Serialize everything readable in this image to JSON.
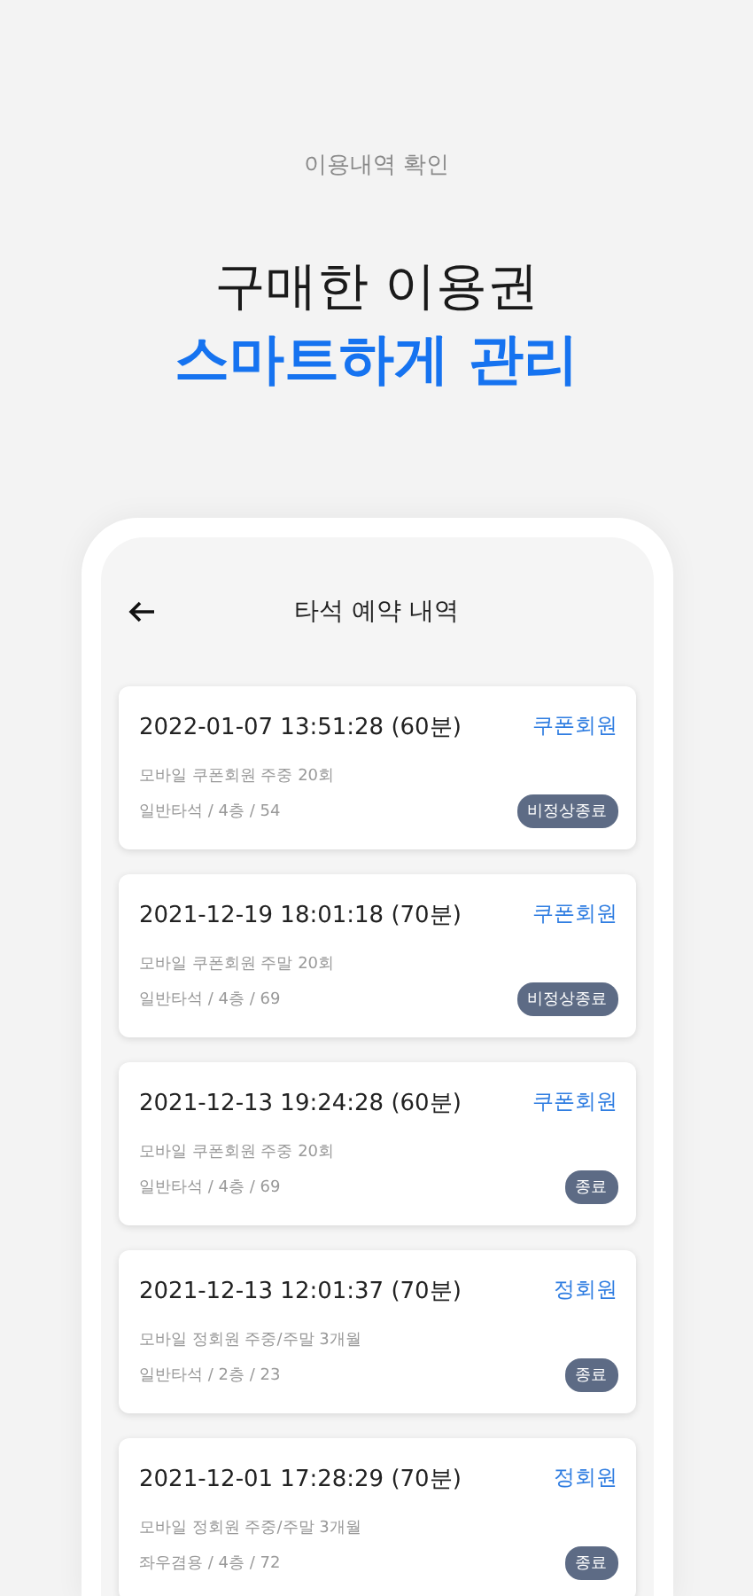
{
  "eyebrow": "이용내역 확인",
  "headline": {
    "line_1": "구매한 이용권",
    "line_2": "스마트하게 관리"
  },
  "screen": {
    "title": "타석 예약 내역",
    "reservations": [
      {
        "datetime": "2022-01-07 13:51:28 (60분)",
        "member_type": "쿠폰회원",
        "pass": "모바일 쿠폰회원 주중 20회",
        "seat": "일반타석 / 4층 / 54",
        "status": "비정상종료"
      },
      {
        "datetime": "2021-12-19 18:01:18 (70분)",
        "member_type": "쿠폰회원",
        "pass": "모바일 쿠폰회원 주말 20회",
        "seat": "일반타석 / 4층 / 69",
        "status": "비정상종료"
      },
      {
        "datetime": "2021-12-13 19:24:28 (60분)",
        "member_type": "쿠폰회원",
        "pass": "모바일 쿠폰회원 주중 20회",
        "seat": "일반타석 / 4층 / 69",
        "status": "종료"
      },
      {
        "datetime": "2021-12-13 12:01:37 (70분)",
        "member_type": "정회원",
        "pass": "모바일 정회원 주중/주말 3개월",
        "seat": "일반타석 / 2층 / 23",
        "status": "종료"
      },
      {
        "datetime": "2021-12-01 17:28:29 (70분)",
        "member_type": "정회원",
        "pass": "모바일 정회원 주중/주말 3개월",
        "seat": "좌우겸용 / 4층 / 72",
        "status": "종료"
      }
    ]
  }
}
